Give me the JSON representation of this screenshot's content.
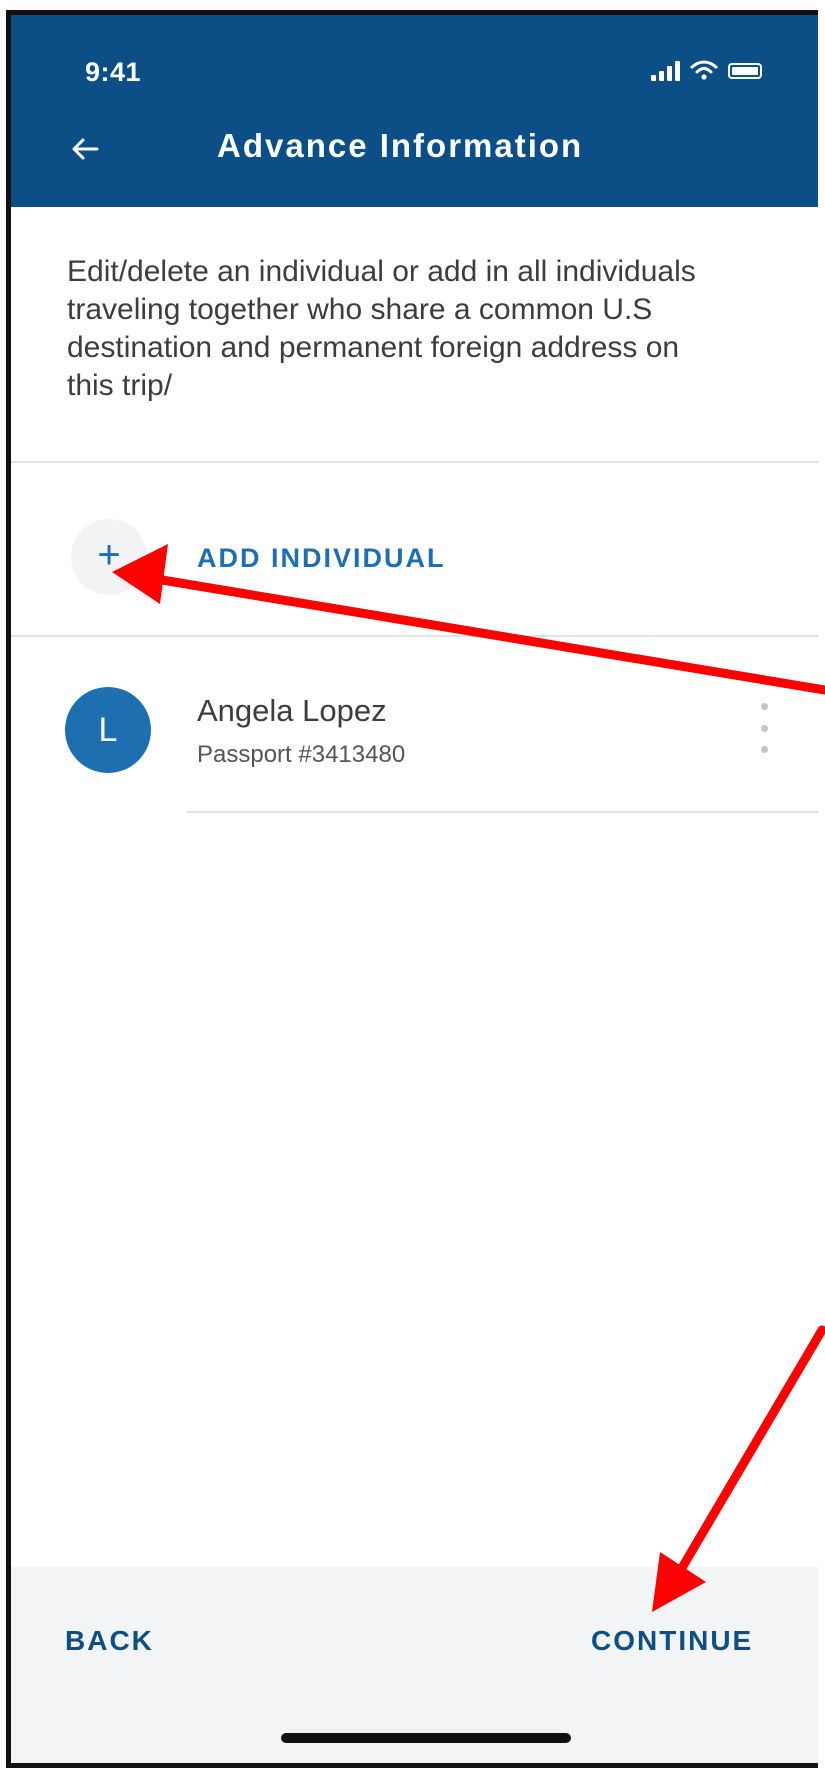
{
  "status_bar": {
    "time": "9:41",
    "signal_icon": "signal-icon",
    "wifi_icon": "wifi-icon",
    "battery_icon": "battery-icon"
  },
  "header": {
    "back_icon": "arrow-left-icon",
    "title": "Advance Information",
    "background_color": "#0b4f86"
  },
  "intro_text": "Edit/delete an individual or add in all individuals traveling together who share a common U.S destination and permanent foreign address on this trip/",
  "add_individual": {
    "icon": "plus-icon",
    "label": "ADD INDIVIDUAL"
  },
  "individuals": [
    {
      "initial": "L",
      "name": "Angela Lopez",
      "passport": "Passport #3413480",
      "menu_icon": "more-vertical-icon"
    }
  ],
  "footer": {
    "back_label": "BACK",
    "continue_label": "CONTINUE"
  },
  "colors": {
    "accent": "#1d6fb0",
    "annotation_arrow": "#ff0000"
  }
}
